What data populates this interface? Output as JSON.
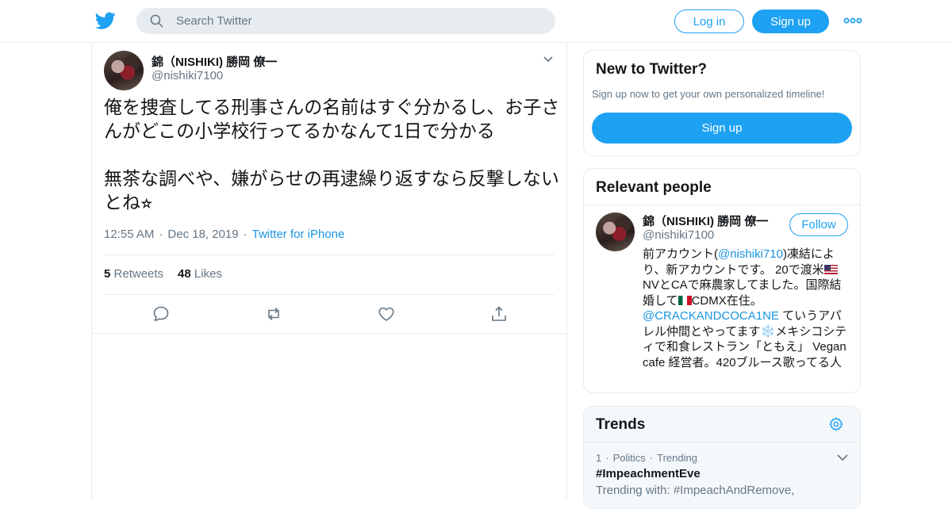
{
  "header": {
    "search_placeholder": "Search Twitter",
    "login_label": "Log in",
    "signup_label": "Sign up"
  },
  "tweet": {
    "author_name": "錦（NISHIKI) 勝岡 僚一",
    "author_handle": "@nishiki7100",
    "text_lines": [
      "俺を捜査してる刑事さんの名前はすぐ分かるし、お子さんがどこの小学校行ってるかなんて1日で分かる",
      "無茶な調べや、嫌がらせの再逮繰り返すなら反撃しないとね⭐︎"
    ],
    "time": "12:55 AM",
    "date": "Dec 18, 2019",
    "source": "Twitter for iPhone",
    "retweets_count": "5",
    "retweets_label": "Retweets",
    "likes_count": "48",
    "likes_label": "Likes"
  },
  "new_to_twitter": {
    "title": "New to Twitter?",
    "subtitle": "Sign up now to get your own personalized timeline!",
    "button_label": "Sign up"
  },
  "relevant_people": {
    "title": "Relevant people",
    "name": "錦（NISHIKI) 勝岡 僚一",
    "handle": "@nishiki7100",
    "follow_label": "Follow",
    "bio_part1": "前アカウント(",
    "bio_mention1": "@nishiki710",
    "bio_part2": ")凍結により、新アカウントです。 20で渡米",
    "bio_part3": "NVとCAで麻農家してました。国際結婚して",
    "bio_part4": "CDMX在住。",
    "bio_mention2": "@CRACKANDCOCA1NE",
    "bio_part5": " ていうアパレル仲間とやってます",
    "bio_snow": "❄️",
    "bio_part6": "メキシコシティで和食レストラン「ともえ」 Vegan cafe 経営者。420ブルース歌ってる人"
  },
  "trends": {
    "title": "Trends",
    "items": [
      {
        "rank": "1",
        "category": "Politics",
        "status": "Trending",
        "name": "#ImpeachmentEve",
        "with": "Trending with: #ImpeachAndRemove,"
      }
    ]
  },
  "colors": {
    "brand": "#1da1f2",
    "link": "#1b95e0",
    "secondary_text": "#657786",
    "border": "#e6ecf0"
  },
  "icons": [
    "twitter-bird-icon",
    "search-icon",
    "more-dots-icon",
    "chevron-down-icon",
    "reply-icon",
    "retweet-icon",
    "like-icon",
    "share-icon",
    "gear-icon"
  ]
}
